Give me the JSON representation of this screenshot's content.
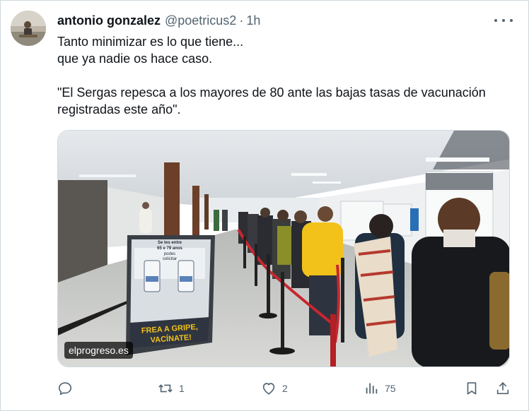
{
  "author": {
    "name": "antonio gonzalez",
    "handle": "@poetricus2",
    "separator": "·",
    "time": "1h"
  },
  "tweet": {
    "lines": [
      "Tanto minimizar es lo que tiene...",
      "que ya nadie os hace caso.",
      "\"El Sergas repesca a los mayores de 80 ante las bajas tasas de vacunación",
      "registradas este año\"."
    ]
  },
  "media": {
    "source_label": "elprogreso.es",
    "poster_lines": [
      "Se tes entre",
      "65 e 79 anos",
      "podes",
      "solicitar"
    ],
    "poster_slogan_1": "FREA A GRIPE,",
    "poster_slogan_2": "VACÍNATE!"
  },
  "actions": {
    "reply": {
      "icon": "reply-icon",
      "count": ""
    },
    "retweet": {
      "icon": "retweet-icon",
      "count": "1"
    },
    "like": {
      "icon": "heart-icon",
      "count": "2"
    },
    "views": {
      "icon": "views-icon",
      "count": "75"
    },
    "bookmark": {
      "icon": "bookmark-icon"
    },
    "share": {
      "icon": "share-icon"
    }
  },
  "colors": {
    "text": "#0f1419",
    "secondary": "#536471",
    "border": "#cfd9de",
    "poster_yellow": "#f2c21a",
    "rope_red": "#c8262f"
  }
}
